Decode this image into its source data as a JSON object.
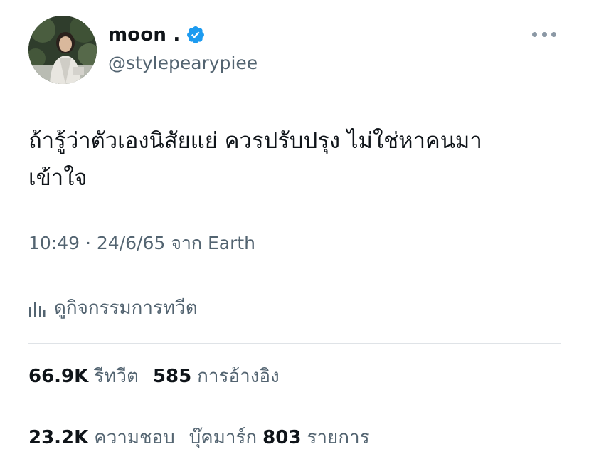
{
  "author": {
    "display_name": "moon .",
    "handle": "@stylepearypiee",
    "verified": true
  },
  "tweet": {
    "text_line1": "ถ้ารู้ว่าตัวเองนิสัยแย่ ควรปรับปรุง ไม่ใช่หาคนมา",
    "text_line2": "เข้าใจ",
    "timestamp": "10:49 · 24/6/65 จาก Earth"
  },
  "activity": {
    "label": "ดูกิจกรรมการทวีต",
    "icon": "analytics-icon"
  },
  "stats": {
    "retweets_count": "66.9K",
    "retweets_label": "รีทวีต",
    "quotes_count": "585",
    "quotes_label": "การอ้างอิง",
    "likes_count": "23.2K",
    "likes_label": "ความชอบ",
    "bookmarks_label": "บุ๊คมาร์ก",
    "bookmarks_count": "803",
    "bookmarks_suffix": "รายการ"
  },
  "colors": {
    "verified_blue": "#1d9bf0",
    "secondary_text": "#536471",
    "primary_text": "#0f1419",
    "divider": "#dfe3e7"
  }
}
